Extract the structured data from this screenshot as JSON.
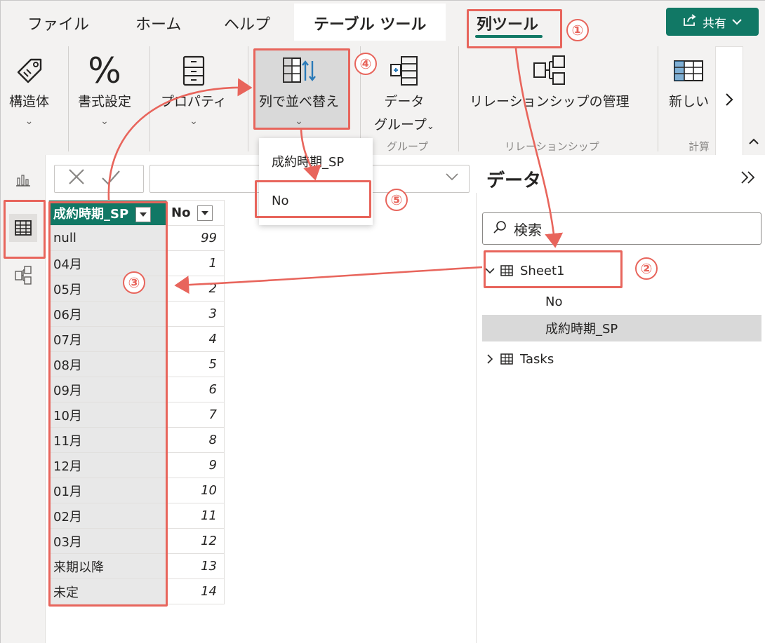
{
  "ribbon_tabs": {
    "file": "ファイル",
    "home": "ホーム",
    "help": "ヘルプ",
    "table_tools": "テーブル ツール",
    "column_tools": "列ツール"
  },
  "share": {
    "label": "共有"
  },
  "ribbon": {
    "structure": "構造体",
    "format": "書式設定",
    "properties": "プロパティ",
    "sort_by_column": "列で並べ替え",
    "data_group_line1": "データ",
    "data_group_line2": "グループ",
    "group_label_groups": "グループ",
    "manage_relationships": "リレーションシップの管理",
    "group_label_relationships": "リレーションシップ",
    "new_column": "新しい",
    "group_label_calc": "計算"
  },
  "dropdown": {
    "items": [
      "成約時期_SP",
      "No"
    ]
  },
  "grid": {
    "headers": [
      "成約時期_SP",
      "No"
    ],
    "rows": [
      [
        "null",
        "99"
      ],
      [
        "04月",
        "1"
      ],
      [
        "05月",
        "2"
      ],
      [
        "06月",
        "3"
      ],
      [
        "07月",
        "4"
      ],
      [
        "08月",
        "5"
      ],
      [
        "09月",
        "6"
      ],
      [
        "10月",
        "7"
      ],
      [
        "11月",
        "8"
      ],
      [
        "12月",
        "9"
      ],
      [
        "01月",
        "10"
      ],
      [
        "02月",
        "11"
      ],
      [
        "03月",
        "12"
      ],
      [
        "来期以降",
        "13"
      ],
      [
        "未定",
        "14"
      ]
    ]
  },
  "data_pane": {
    "title": "データ",
    "search_placeholder": "検索",
    "tables": [
      {
        "name": "Sheet1",
        "expanded": true,
        "fields": [
          "No",
          "成約時期_SP"
        ]
      },
      {
        "name": "Tasks",
        "expanded": false,
        "fields": []
      }
    ]
  },
  "annotations": {
    "step1": "①",
    "step2": "②",
    "step3": "③",
    "step4": "④",
    "step5": "⑤"
  },
  "colors": {
    "accent": "#117865",
    "annotation": "#e8655c",
    "selected_row": "#d9d9d9"
  }
}
